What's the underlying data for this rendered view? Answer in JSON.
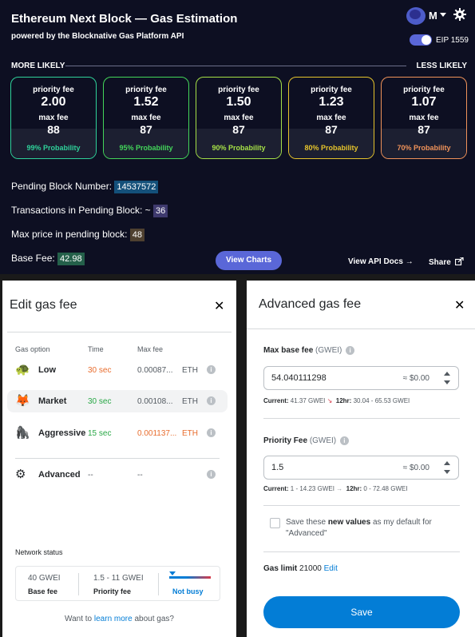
{
  "header": {
    "title": "Ethereum Next Block — Gas Estimation",
    "subtitle": "powered by the Blocknative Gas Platform API",
    "account_letter": "M",
    "eip_label": "EIP 1559",
    "more_likely": "MORE LIKELY",
    "less_likely": "LESS LIKELY"
  },
  "cards": [
    {
      "pf_label": "priority fee",
      "pf": "2.00",
      "mf_label": "max fee",
      "mf": "88",
      "prob": "99% Probability",
      "color": "#2fd29a"
    },
    {
      "pf_label": "priority fee",
      "pf": "1.52",
      "mf_label": "max fee",
      "mf": "87",
      "prob": "95% Probability",
      "color": "#43d65a"
    },
    {
      "pf_label": "priority fee",
      "pf": "1.50",
      "mf_label": "max fee",
      "mf": "87",
      "prob": "90% Probability",
      "color": "#a5e047"
    },
    {
      "pf_label": "priority fee",
      "pf": "1.23",
      "mf_label": "max fee",
      "mf": "87",
      "prob": "80% Probability",
      "color": "#e6c42c"
    },
    {
      "pf_label": "priority fee",
      "pf": "1.07",
      "mf_label": "max fee",
      "mf": "87",
      "prob": "70% Probability",
      "color": "#f0935a"
    }
  ],
  "stats": {
    "pending_block_label": "Pending Block Number:",
    "pending_block": "14537572",
    "tx_label": "Transactions in Pending Block: ~",
    "tx": "36",
    "max_price_label": "Max price in pending block:",
    "max_price": "48",
    "base_fee_label": "Base Fee:",
    "base_fee": "42.98"
  },
  "footer": {
    "view_charts": "View Charts",
    "api_docs": "View API Docs →",
    "share": "Share"
  },
  "edit_gas": {
    "title": "Edit gas fee",
    "col_option": "Gas option",
    "col_time": "Time",
    "col_fee": "Max fee",
    "options": [
      {
        "name": "Low",
        "icon": "🐢",
        "time": "30 sec",
        "fee": "0.00087...",
        "unit": "ETH",
        "time_color": "#e86d2e",
        "fee_color": "#535a61"
      },
      {
        "name": "Market",
        "icon": "🦊",
        "time": "30 sec",
        "fee": "0.00108...",
        "unit": "ETH",
        "time_color": "#28a745",
        "fee_color": "#535a61"
      },
      {
        "name": "Aggressive",
        "icon": "🦍",
        "time": "15 sec",
        "fee": "0.001137...",
        "unit": "ETH",
        "time_color": "#28a745",
        "fee_color": "#e86d2e"
      },
      {
        "name": "Advanced",
        "icon": "⚙",
        "time": "--",
        "fee": "--",
        "unit": "",
        "time_color": "#535a61",
        "fee_color": "#535a61"
      }
    ],
    "network_status": "Network status",
    "base_fee_val": "40 GWEI",
    "base_fee_lbl": "Base fee",
    "priority_val": "1.5 - 11 GWEI",
    "priority_lbl": "Priority fee",
    "busy_lbl": "Not busy",
    "learn_pre": "Want to ",
    "learn_link": "learn more",
    "learn_post": " about gas?"
  },
  "advanced": {
    "title": "Advanced gas fee",
    "max_base_label": "Max base fee",
    "max_base_unit": "(GWEI)",
    "max_base_value": "54.040111298",
    "max_base_usd": "≈ $0.00",
    "max_base_current_lbl": "Current:",
    "max_base_current": "41.37 GWEI",
    "max_base_12h_lbl": "12hr:",
    "max_base_12h": "30.04 - 65.53 GWEI",
    "priority_label": "Priority Fee",
    "priority_unit": "(GWEI)",
    "priority_value": "1.5",
    "priority_usd": "≈ $0.00",
    "priority_current_lbl": "Current:",
    "priority_current": "1 - 14.23 GWEI",
    "priority_12h_lbl": "12hr:",
    "priority_12h": "0 - 72.48 GWEI",
    "save_default_pre": "Save these ",
    "save_default_bold": "new values",
    "save_default_post": " as my default for \"Advanced\"",
    "gas_limit_label": "Gas limit",
    "gas_limit_value": "21000",
    "gas_limit_edit": "Edit",
    "save_btn": "Save"
  },
  "colors": {
    "accent": "#037dd6",
    "dark_bg": "#0d0f22",
    "purple": "#5a67d8"
  }
}
